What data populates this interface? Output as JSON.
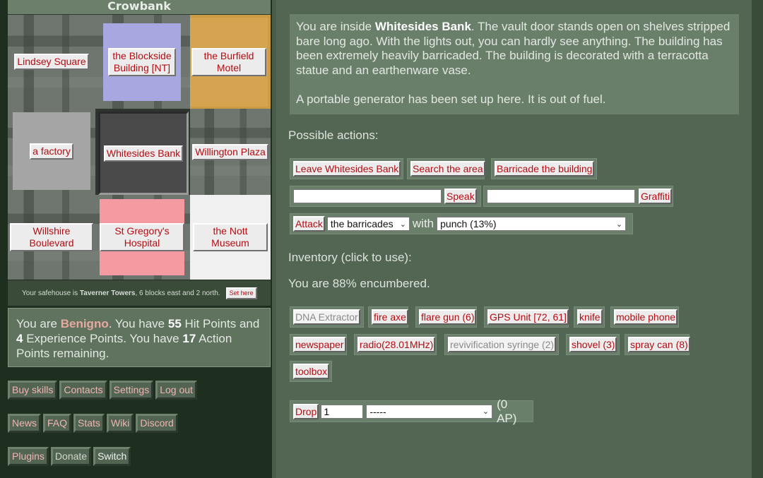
{
  "map": {
    "suburb": "Crowbank",
    "cells": {
      "lindsey": "Lindsey Square",
      "blockside": "the Blockside Building [NT]",
      "burfield": "the Burfield Motel",
      "factory": "a factory",
      "whitesides": "Whitesides Bank",
      "willington": "Willington Plaza",
      "willshire": "Willshire Boulevard",
      "gregory": "St Gregory's Hospital",
      "nott": "the Nott Museum"
    }
  },
  "safehouse": {
    "prefix": "Your safehouse is ",
    "name": "Taverner Towers",
    "suffix": ", 6 blocks east and 2 north.",
    "button": "Set here"
  },
  "status": {
    "p1": "You are ",
    "name": "Benigno",
    "p2": ". You have ",
    "hp": "55",
    "p3": " Hit Points and ",
    "xp": "4",
    "p4": " Experience Points. You have ",
    "ap": "17",
    "p5": " Action Points remaining."
  },
  "links": {
    "row1": [
      "Buy skills",
      "Contacts",
      "Settings",
      "Log out"
    ],
    "row2": [
      "News",
      "FAQ",
      "Stats",
      "Wiki",
      "Discord"
    ],
    "row3": [
      "Plugins",
      "Donate",
      "Switch"
    ]
  },
  "description": {
    "p1a": "You are inside ",
    "building": "Whitesides Bank",
    "p1b": ". The vault door stands open on shelves stripped bare long ago. With the lights out, you can hardly see anything. The building has been extremely heavily barricaded. The building is decorated with a terracotta statue and an earthenware vase.",
    "p2": "A portable generator has been set up here. It is out of fuel."
  },
  "actions": {
    "heading": "Possible actions:",
    "leave": "Leave Whitesides Bank",
    "search": "Search the area",
    "barricade": "Barricade the building",
    "speak": "Speak",
    "speak_value": "",
    "graffiti": "Graffiti",
    "graffiti_value": "",
    "attack": "Attack",
    "target": "the barricades",
    "with": "with",
    "weapon": "punch (13%)"
  },
  "inventory": {
    "heading": "Inventory (click to use):",
    "encumbrance": "You are 88% encumbered.",
    "row1": [
      "DNA Extractor",
      "fire axe",
      "flare gun (6)",
      "GPS Unit [72, 61]",
      "knife",
      "mobile phone"
    ],
    "row2": [
      "newspaper",
      "radio(28.01MHz)",
      "revivification syringe (2)",
      "shovel (3)",
      "spray can (8)"
    ],
    "row3": [
      "toolbox"
    ]
  },
  "drop": {
    "button": "Drop",
    "quantity": "1",
    "item": "-----",
    "cost": "(0 AP)"
  }
}
